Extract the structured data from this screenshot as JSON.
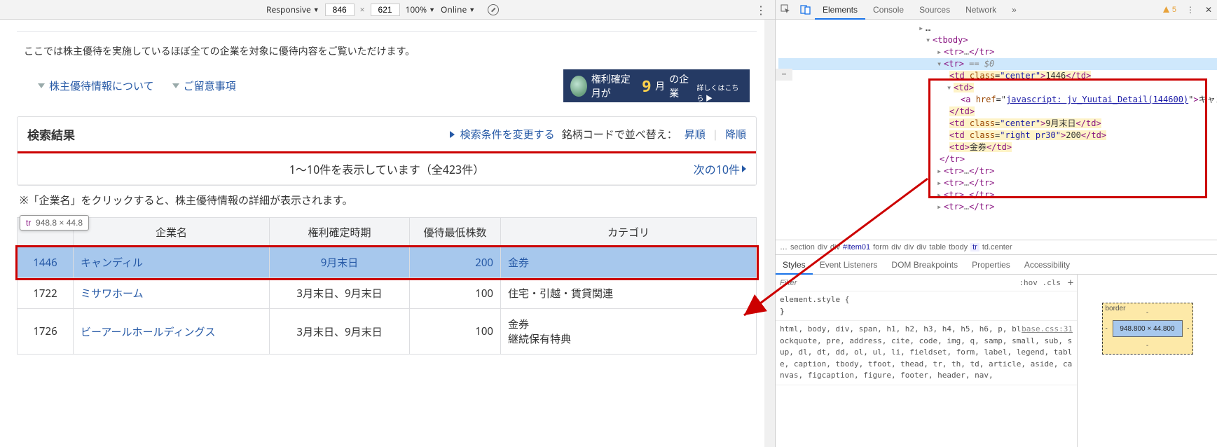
{
  "toolbar": {
    "mode": "Responsive",
    "width": "846",
    "height": "621",
    "zoom": "100%",
    "throttle": "Online"
  },
  "devtools": {
    "tabs": [
      "Elements",
      "Console",
      "Sources",
      "Network"
    ],
    "active_tab": "Elements",
    "warning_count": "5",
    "breadcrumb": [
      "…",
      "section",
      "div",
      "div",
      "#item01",
      "form",
      "div",
      "div",
      "div",
      "table",
      "tbody",
      "tr",
      "td.center"
    ],
    "styles_tabs": [
      "Styles",
      "Event Listeners",
      "DOM Breakpoints",
      "Properties",
      "Accessibility"
    ],
    "filter_placeholder": "Filter",
    "hov_cls": ":hov .cls",
    "element_style": "element.style {",
    "reset_selector": "html, body, div, span, h1, h2, h3, h4, h5, h6, p, blockquote, pre, address, cite, code, img, q, samp, small, sub, sup, dl, dt, dd, ol, ul, li, fieldset, form, label, legend, table, caption, tbody, tfoot, thead, tr, th, td, article, aside, canvas, figcaption, figure, footer, header, nav,",
    "reset_src": "base.css:31",
    "box_model": {
      "label": "border",
      "dims": "948.800 × 44.800"
    }
  },
  "page": {
    "desc": "ここでは株主優待を実施しているほぼ全ての企業を対象に優待内容をご覧いただけます。",
    "link1": "株主優待情報について",
    "link2": "ご留意事項",
    "banner_text1": "権利確定月が",
    "banner_big": "9",
    "banner_text2": "月",
    "banner_text3": "の企業",
    "banner_sub": "詳しくはこちら ▶",
    "result_title": "検索結果",
    "change_cond": "検索条件を変更する",
    "sort_label": "銘柄コードで並べ替え：",
    "sort_asc": "昇順",
    "sort_desc": "降順",
    "pager": "1〜10件を表示しています（全423件）",
    "next_page": "次の10件",
    "note": "※「企業名」をクリックすると、株主優待情報の詳細が表示されます。",
    "hover_tag": "tr",
    "hover_dim": "948.8 × 44.8",
    "headers": [
      "",
      "企業名",
      "権利確定時期",
      "優待最低株数",
      "カテゴリ"
    ],
    "rows": [
      {
        "code": "1446",
        "name": "キャンディル",
        "period": "9月末日",
        "shares": "200",
        "category": "金券",
        "selected": true
      },
      {
        "code": "1722",
        "name": "ミサワホーム",
        "period": "3月末日、9月末日",
        "shares": "100",
        "category": "住宅・引越・賃貸関連"
      },
      {
        "code": "1726",
        "name": "ビーアールホールディングス",
        "period": "3月末日、9月末日",
        "shares": "100",
        "category": "金券\n継続保有特典"
      }
    ]
  },
  "dom": {
    "row": {
      "code": "1446",
      "href": "javascript: jv_Yuutai_Detail(144600)",
      "name": "キャンディル",
      "period": "9月末日",
      "shares": "200",
      "category": "金券"
    }
  }
}
